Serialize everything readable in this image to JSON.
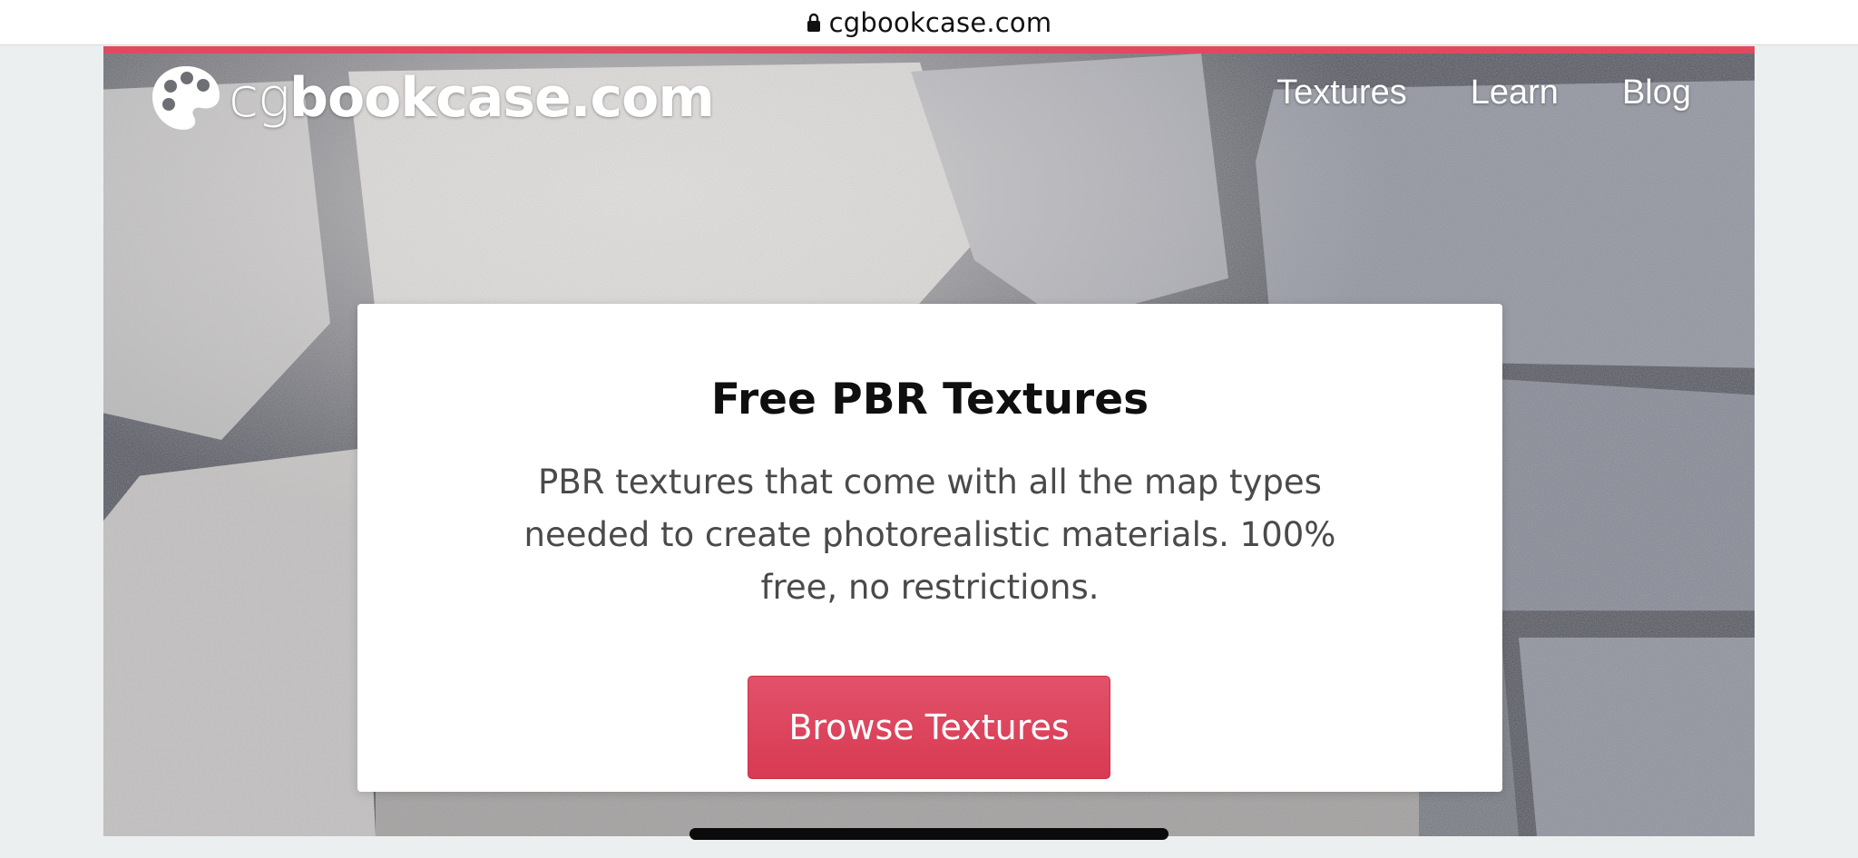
{
  "browser": {
    "url": "cgbookcase.com"
  },
  "site": {
    "logo_light": "cg",
    "logo_bold": "bookcase",
    "logo_dot_com": ".com",
    "nav": [
      {
        "label": "Textures"
      },
      {
        "label": "Learn"
      },
      {
        "label": "Blog"
      }
    ]
  },
  "hero": {
    "title": "Free PBR Textures",
    "description": "PBR textures that come with all the map types needed to create photorealistic materials. 100% free, no restrictions.",
    "cta_label": "Browse Textures"
  },
  "colors": {
    "accent": "#e04a5e",
    "button": "#dc4259"
  },
  "icons": {
    "lock": "lock-icon",
    "logo": "palette-icon"
  }
}
